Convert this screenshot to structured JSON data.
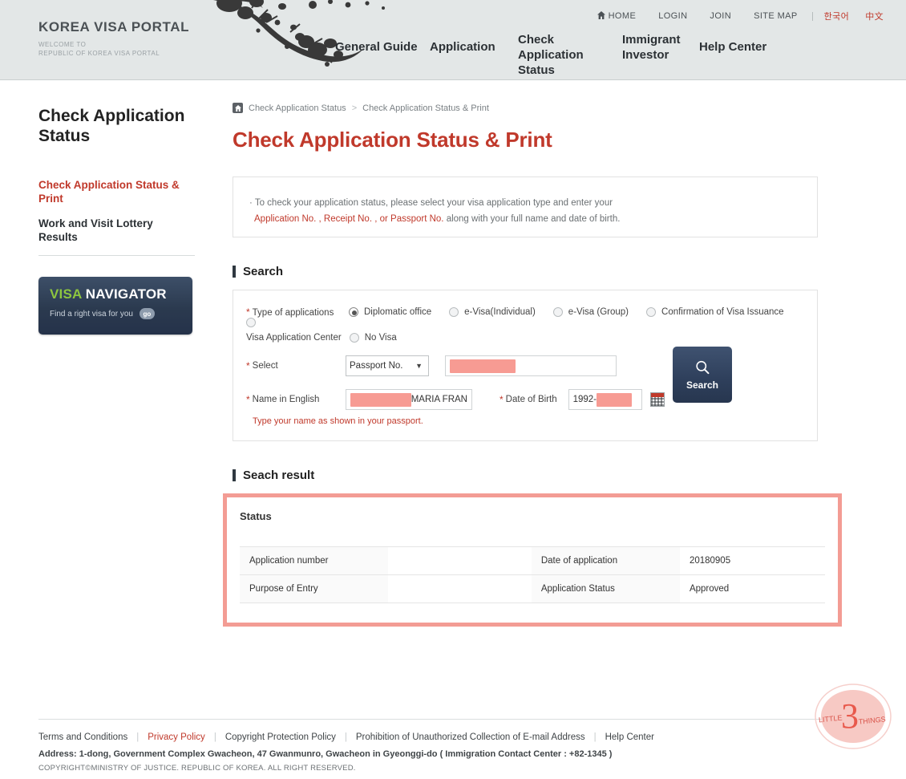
{
  "header": {
    "brand_title": "KOREA VISA PORTAL",
    "brand_sub_line1": "WELCOME TO",
    "brand_sub_line2": "REPUBLIC OF KOREA VISA PORTAL",
    "util_nav": [
      {
        "label": "HOME",
        "icon": "home-icon"
      },
      {
        "label": "LOGIN",
        "icon": ""
      },
      {
        "label": "JOIN",
        "icon": ""
      },
      {
        "label": "SITE MAP",
        "icon": ""
      }
    ],
    "languages": [
      {
        "label": "한국어"
      },
      {
        "label": "中文"
      }
    ],
    "main_nav": [
      {
        "label": "General Guide",
        "active": false
      },
      {
        "label": "Application",
        "active": false
      },
      {
        "label": "Check Application Status",
        "active": true
      },
      {
        "label": "Immigrant Investor",
        "active": false
      },
      {
        "label": "Help Center",
        "active": false
      }
    ],
    "ink_art": "plum-blossom-ink-art"
  },
  "sidebar": {
    "title": "Check Application Status",
    "items": [
      {
        "label": "Check Application Status & Print",
        "active": true
      },
      {
        "label": "Work and Visit Lottery Results",
        "active": false
      }
    ],
    "navigator": {
      "logo_accent": "VISA",
      "logo_rest": " NAVIGATOR",
      "tagline": "Find a right visa for you",
      "go_label": "go"
    }
  },
  "breadcrumb": {
    "home_icon": "home-icon",
    "items": [
      "Check Application Status",
      "Check Application Status & Print"
    ],
    "separator": ">"
  },
  "page_title": "Check Application Status & Print",
  "notice": {
    "bullet": "·",
    "line1": "To check your application status, please select your visa application type and enter your",
    "highlight": "Application No. , Receipt No. , or Passport No.",
    "line2_rest": " along with your full name and date of birth."
  },
  "search_section": {
    "heading": "Search",
    "type_label": "Type of applications",
    "wrap_label": "Visa Application Center",
    "required_mark": "*",
    "options": [
      {
        "label": "Diplomatic office",
        "selected": true
      },
      {
        "label": "e-Visa(Individual)",
        "selected": false
      },
      {
        "label": "e-Visa (Group)",
        "selected": false
      },
      {
        "label": "Confirmation of Visa Issuance",
        "selected": false
      },
      {
        "label": "",
        "selected": false
      },
      {
        "label": "No Visa",
        "selected": false
      }
    ],
    "select_label": "Select",
    "select_value": "Passport No.",
    "select_options": [
      "Application No.",
      "Receipt No.",
      "Passport No."
    ],
    "select_caret": "▼",
    "id_value": "",
    "id_redacted": true,
    "name_label": "Name in English",
    "name_value": "MARIA FRAN",
    "name_redacted": true,
    "dob_label": "Date of Birth",
    "dob_value": "1992-",
    "dob_redacted": true,
    "calendar_icon": "calendar-icon",
    "hint": "Type your name as shown in your passport.",
    "search_button": "Search",
    "search_icon": "magnifier-icon"
  },
  "result_section": {
    "heading": "Seach result",
    "status_title": "Status",
    "rows": [
      {
        "key1": "Application number",
        "val1": "",
        "key2": "Date of application",
        "val2": "20180905"
      },
      {
        "key1": "Purpose of Entry",
        "val1": "",
        "key2": "Application Status",
        "val2": "Approved"
      }
    ]
  },
  "footer": {
    "links": [
      {
        "label": "Terms and Conditions",
        "accent": false
      },
      {
        "label": "Privacy Policy",
        "accent": true
      },
      {
        "label": "Copyright Protection Policy",
        "accent": false
      },
      {
        "label": "Prohibition of Unauthorized Collection of E-mail Address",
        "accent": false
      },
      {
        "label": "Help Center",
        "accent": false
      }
    ],
    "separator": "|",
    "address": "Address: 1-dong, Government Complex Gwacheon, 47 Gwanmunro, Gwacheon in Gyeonggi-do ( Immigration Contact Center : +82-1345 )",
    "copyright": "COPYRIGHT©MINISTRY OF JUSTICE. REPUBLIC OF KOREA. ALL RIGHT RESERVED.",
    "watermark": {
      "number": "3",
      "word_left": "LITTLE",
      "word_right": "THINGS"
    }
  },
  "colors": {
    "accent_red": "#c0392b",
    "header_bg": "#e3e7e7",
    "navy": "#2e3f5b",
    "redact_pink": "#f79b93",
    "result_border": "#f39c94",
    "green": "#8dc63f"
  }
}
